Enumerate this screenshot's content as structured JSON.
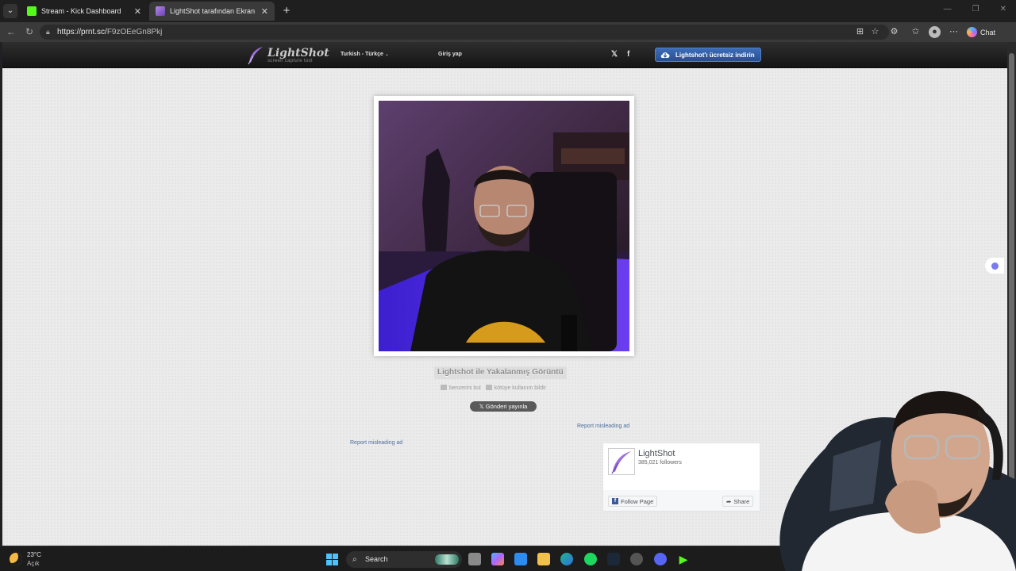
{
  "browser": {
    "tabs": [
      {
        "title": "Stream - Kick Dashboard",
        "icon": "kick-icon",
        "active": false
      },
      {
        "title": "LightShot tarafından Ekran Görüntü",
        "icon": "lightshot-feather-icon",
        "active": true
      }
    ],
    "url_host": "https://prnt.sc/",
    "url_path": "F9zOEeGn8Pkj",
    "chat_label": "Chat"
  },
  "lightshot": {
    "logo_title": "LightShot",
    "logo_subtitle": "screen capture tool",
    "language": "Turkish - Türkçe",
    "login": "Giriş yap",
    "twitter_glyph": "𝕏",
    "facebook_glyph": "f",
    "download_button": "Lightshot'ı ücretsiz indirin",
    "caption": "Lightshot ile Yakalanmış Görüntü",
    "find_similar": "benzerini bul",
    "report_abuse": "kötüye kullanım bildir",
    "x_post": "Gönderi yayınla",
    "report_ad_right": "Report misleading ad",
    "report_ad_left": "Report misleading ad"
  },
  "facebook_widget": {
    "page_name": "LightShot",
    "followers": "385,021 followers",
    "follow_button": "Follow Page",
    "share_button": "Share"
  },
  "taskbar": {
    "weather_temp": "23°C",
    "weather_condition": "Açık",
    "search_placeholder": "Search"
  },
  "colors": {
    "download_button": "#2f5ca3",
    "page_bg": "#ebebeb",
    "header_bg": "#1e1e1e",
    "report_link": "#4e6f9c",
    "facebook_blue": "#3b5998"
  }
}
